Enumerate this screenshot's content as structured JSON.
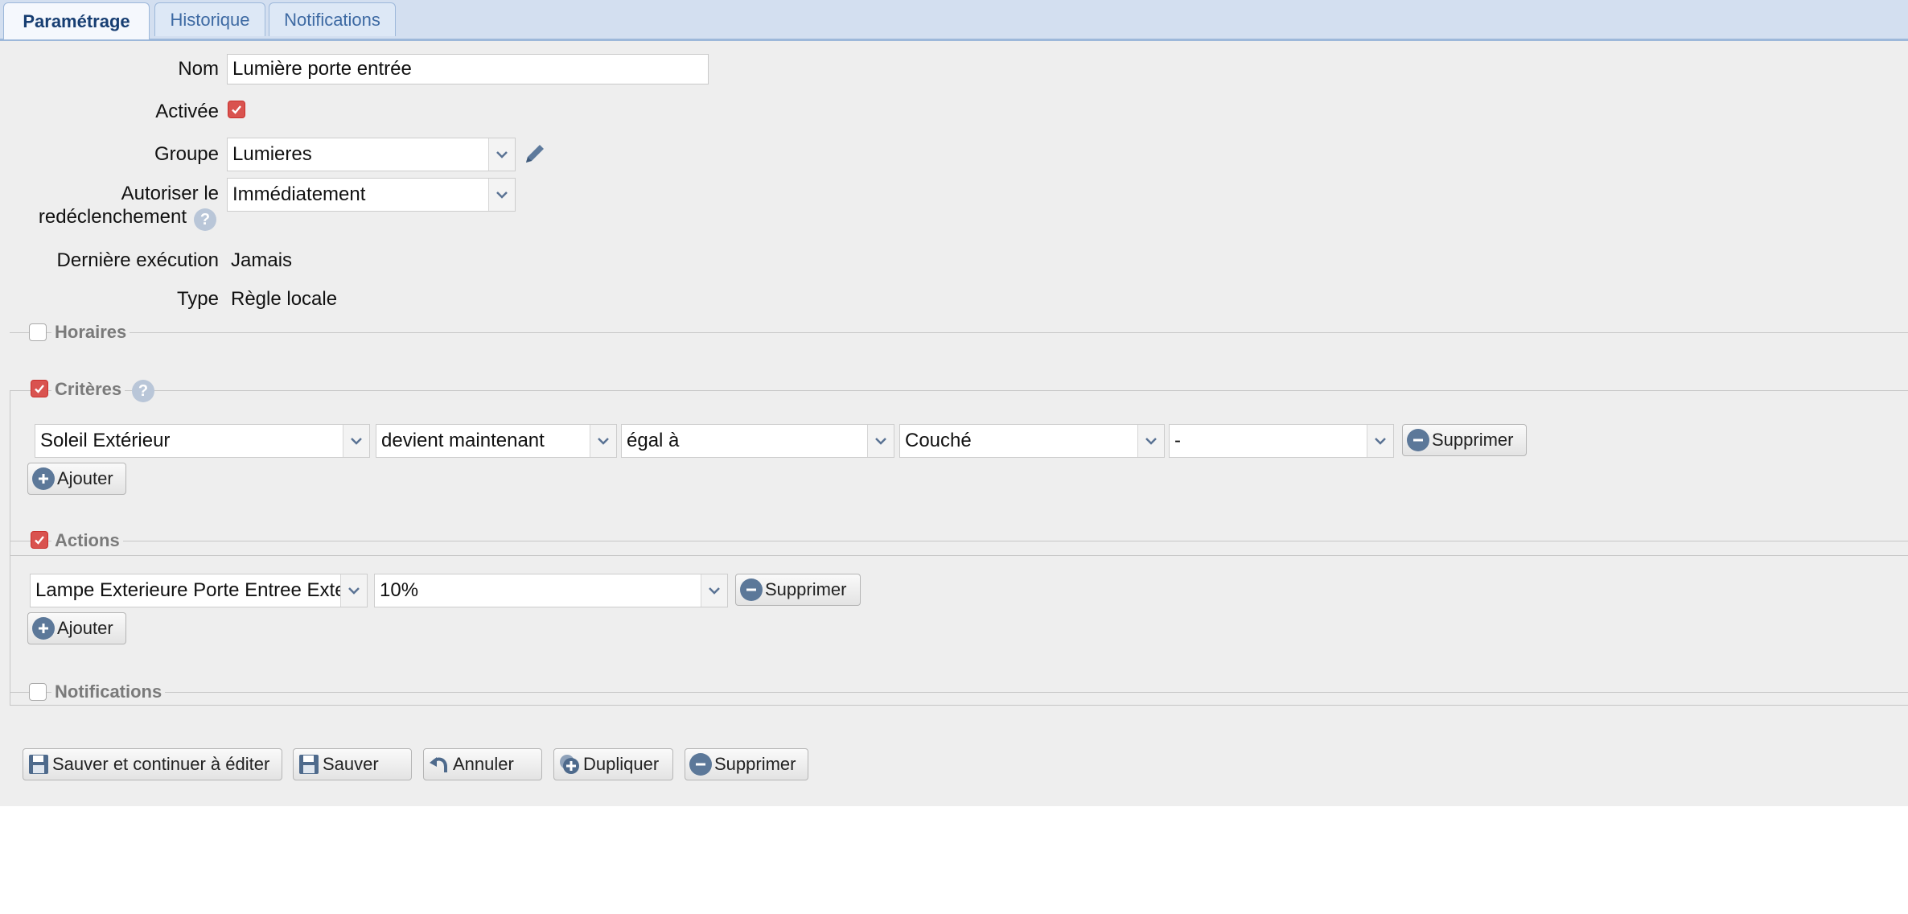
{
  "tabs": [
    {
      "label": "Paramétrage",
      "active": true
    },
    {
      "label": "Historique",
      "active": false
    },
    {
      "label": "Notifications",
      "active": false
    }
  ],
  "form": {
    "nom_label": "Nom",
    "nom_value": "Lumière porte entrée",
    "activee_label": "Activée",
    "activee_checked": true,
    "groupe_label": "Groupe",
    "groupe_value": "Lumieres",
    "autoriser_label_line1": "Autoriser le",
    "autoriser_label_line2": "redéclenchement",
    "autoriser_value": "Immédiatement",
    "derniere_label": "Dernière exécution",
    "derniere_value": "Jamais",
    "type_label": "Type",
    "type_value": "Règle locale"
  },
  "sections": {
    "horaires": {
      "label": "Horaires",
      "checked": false
    },
    "criteres": {
      "label": "Critères",
      "checked": true
    },
    "actions": {
      "label": "Actions",
      "checked": true
    },
    "notifications": {
      "label": "Notifications",
      "checked": false
    }
  },
  "criteria_row": {
    "device": "Soleil Extérieur",
    "condition": "devient maintenant",
    "operator": "égal à",
    "value": "Couché",
    "extra": "-",
    "remove_label": "Supprimer"
  },
  "criteria_add_label": "Ajouter",
  "action_row": {
    "device": "Lampe Exterieure Porte Entree Exte",
    "value": "10%",
    "remove_label": "Supprimer"
  },
  "action_add_label": "Ajouter",
  "bottom_buttons": {
    "save_continue": "Sauver et continuer à éditer",
    "save": "Sauver",
    "cancel": "Annuler",
    "duplicate": "Dupliquer",
    "delete": "Supprimer"
  },
  "help_glyph": "?",
  "colors": {
    "tab_active_text": "#173e72",
    "checkbox_checked": "#d9534f",
    "panel_bg": "#eeeeee",
    "icon_blue": "#5c7899"
  }
}
